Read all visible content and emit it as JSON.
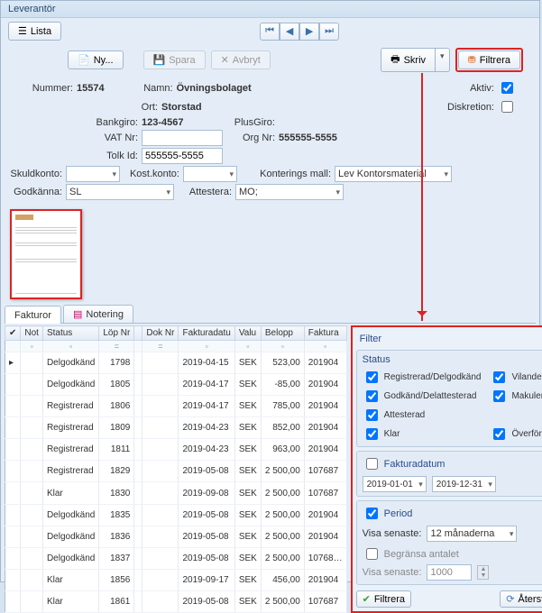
{
  "window": {
    "title": "Leverantör"
  },
  "toolbar": {
    "lista": "Lista",
    "ny": "Ny...",
    "spara": "Spara",
    "avbryt": "Avbryt",
    "skriv": "Skriv",
    "filtrera": "Filtrera"
  },
  "form": {
    "nummer_lbl": "Nummer:",
    "nummer": "15574",
    "namn_lbl": "Namn:",
    "namn": "Övningsbolaget",
    "aktiv_lbl": "Aktiv:",
    "diskretion_lbl": "Diskretion:",
    "ort_lbl": "Ort:",
    "ort": "Storstad",
    "bankgiro_lbl": "Bankgiro:",
    "bankgiro": "123-4567",
    "plusgiro_lbl": "PlusGiro:",
    "vat_lbl": "VAT Nr:",
    "vat": "",
    "orgnr_lbl": "Org Nr:",
    "orgnr": "555555-5555",
    "tolkid_lbl": "Tolk Id:",
    "tolkid": "555555-5555",
    "skuldkonto_lbl": "Skuldkonto:",
    "kostkonto_lbl": "Kost.konto:",
    "konteringsmall_lbl": "Konterings mall:",
    "konteringsmall": "Lev Kontorsmaterial",
    "godkanna_lbl": "Godkänna:",
    "godkanna": "SL",
    "attestera_lbl": "Attestera:",
    "attestera": "MO;"
  },
  "tabs": {
    "fakturor": "Fakturor",
    "notering": "Notering"
  },
  "grid": {
    "headers": [
      "Not",
      "Status",
      "Löp Nr",
      "",
      "Dok Nr",
      "Fakturadatu",
      "Valu",
      "Belopp",
      "Faktura"
    ],
    "rows": [
      {
        "status": "Delgodkänd",
        "lop": "1798",
        "dok": "",
        "datum": "2019-04-15",
        "valu": "SEK",
        "belopp": "523,00",
        "fakt": "201904"
      },
      {
        "status": "Delgodkänd",
        "lop": "1805",
        "dok": "",
        "datum": "2019-04-17",
        "valu": "SEK",
        "belopp": "-85,00",
        "fakt": "201904"
      },
      {
        "status": "Registrerad",
        "lop": "1806",
        "dok": "",
        "datum": "2019-04-17",
        "valu": "SEK",
        "belopp": "785,00",
        "fakt": "201904"
      },
      {
        "status": "Registrerad",
        "lop": "1809",
        "dok": "",
        "datum": "2019-04-23",
        "valu": "SEK",
        "belopp": "852,00",
        "fakt": "201904"
      },
      {
        "status": "Registrerad",
        "lop": "1811",
        "dok": "",
        "datum": "2019-04-23",
        "valu": "SEK",
        "belopp": "963,00",
        "fakt": "201904"
      },
      {
        "status": "Registrerad",
        "lop": "1829",
        "dok": "",
        "datum": "2019-05-08",
        "valu": "SEK",
        "belopp": "2 500,00",
        "fakt": "107687"
      },
      {
        "status": "Klar",
        "lop": "1830",
        "dok": "",
        "datum": "2019-09-08",
        "valu": "SEK",
        "belopp": "2 500,00",
        "fakt": "107687"
      },
      {
        "status": "Delgodkänd",
        "lop": "1835",
        "dok": "",
        "datum": "2019-05-08",
        "valu": "SEK",
        "belopp": "2 500,00",
        "fakt": "201904"
      },
      {
        "status": "Delgodkänd",
        "lop": "1836",
        "dok": "",
        "datum": "2019-05-08",
        "valu": "SEK",
        "belopp": "2 500,00",
        "fakt": "201904"
      },
      {
        "status": "Delgodkänd",
        "lop": "1837",
        "dok": "",
        "datum": "2019-05-08",
        "valu": "SEK",
        "belopp": "2 500,00",
        "fakt": "10768…"
      },
      {
        "status": "Klar",
        "lop": "1856",
        "dok": "",
        "datum": "2019-09-17",
        "valu": "SEK",
        "belopp": "456,00",
        "fakt": "201904"
      },
      {
        "status": "Klar",
        "lop": "1861",
        "dok": "",
        "datum": "2019-05-08",
        "valu": "SEK",
        "belopp": "2 500,00",
        "fakt": "107687"
      }
    ]
  },
  "filter": {
    "title": "Filter",
    "status_title": "Status",
    "registrerad": "Registrerad/Delgodkänd",
    "vilande": "Vilande",
    "godkand": "Godkänd/Delattesterad",
    "makulerad": "Makulerad",
    "attesterad": "Attesterad",
    "klar": "Klar",
    "overford": "Överförd",
    "fakturadatum_title": "Fakturadatum",
    "date_from": "2019-01-01",
    "date_to": "2019-12-31",
    "period_title": "Period",
    "visa_senaste_lbl": "Visa senaste:",
    "period_value": "12 månaderna",
    "begransa_title": "Begränsa antalet",
    "begransa_lbl": "Visa senaste:",
    "begransa_value": "1000",
    "filtrera_btn": "Filtrera",
    "aterstall_btn": "Återställ"
  }
}
